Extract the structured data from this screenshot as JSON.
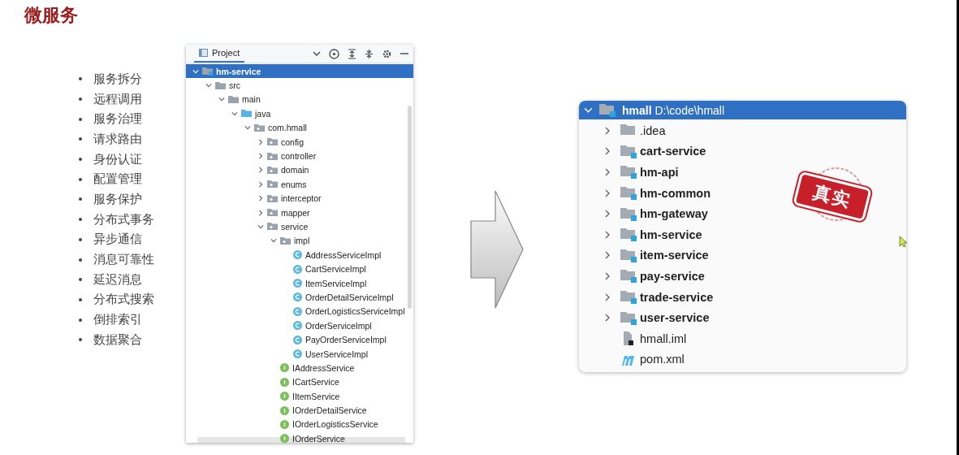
{
  "title": "微服务",
  "topics": [
    "服务拆分",
    "远程调用",
    "服务治理",
    "请求路由",
    "身份认证",
    "配置管理",
    "服务保护",
    "分布式事务",
    "异步通信",
    "消息可靠性",
    "延迟消息",
    "分布式搜索",
    "倒排索引",
    "数据聚合"
  ],
  "project_panel": {
    "tab": "Project",
    "tree": [
      {
        "label": "hm-service",
        "kind": "module",
        "expanded": true,
        "selected": true,
        "children": [
          {
            "label": "src",
            "kind": "folder",
            "expanded": true,
            "selected": false,
            "children": [
              {
                "label": "main",
                "kind": "folder",
                "expanded": true,
                "selected": false,
                "children": [
                  {
                    "label": "java",
                    "kind": "source",
                    "expanded": true,
                    "selected": false,
                    "children": [
                      {
                        "label": "com.hmall",
                        "kind": "package",
                        "expanded": true,
                        "selected": false,
                        "children": [
                          {
                            "label": "config",
                            "kind": "package",
                            "expanded": false,
                            "selected": false
                          },
                          {
                            "label": "controller",
                            "kind": "package",
                            "expanded": false,
                            "selected": false
                          },
                          {
                            "label": "domain",
                            "kind": "package",
                            "expanded": false,
                            "selected": false
                          },
                          {
                            "label": "enums",
                            "kind": "package",
                            "expanded": false,
                            "selected": false
                          },
                          {
                            "label": "interceptor",
                            "kind": "package",
                            "expanded": false,
                            "selected": false
                          },
                          {
                            "label": "mapper",
                            "kind": "package",
                            "expanded": false,
                            "selected": false
                          },
                          {
                            "label": "service",
                            "kind": "package",
                            "expanded": true,
                            "selected": false,
                            "children": [
                              {
                                "label": "impl",
                                "kind": "package",
                                "expanded": true,
                                "selected": false,
                                "children": [
                                  {
                                    "label": "AddressServiceImpl",
                                    "kind": "class",
                                    "selected": false
                                  },
                                  {
                                    "label": "CartServiceImpl",
                                    "kind": "class",
                                    "selected": false
                                  },
                                  {
                                    "label": "ItemServiceImpl",
                                    "kind": "class",
                                    "selected": false
                                  },
                                  {
                                    "label": "OrderDetailServiceImpl",
                                    "kind": "class",
                                    "selected": false
                                  },
                                  {
                                    "label": "OrderLogisticsServiceImpl",
                                    "kind": "class",
                                    "selected": false
                                  },
                                  {
                                    "label": "OrderServiceImpl",
                                    "kind": "class",
                                    "selected": false
                                  },
                                  {
                                    "label": "PayOrderServiceImpl",
                                    "kind": "class",
                                    "selected": false
                                  },
                                  {
                                    "label": "UserServiceImpl",
                                    "kind": "class",
                                    "selected": false
                                  }
                                ]
                              },
                              {
                                "label": "IAddressService",
                                "kind": "interface",
                                "selected": false
                              },
                              {
                                "label": "ICartService",
                                "kind": "interface",
                                "selected": false
                              },
                              {
                                "label": "IItemService",
                                "kind": "interface",
                                "selected": false
                              },
                              {
                                "label": "IOrderDetailService",
                                "kind": "interface",
                                "selected": false
                              },
                              {
                                "label": "IOrderLogisticsService",
                                "kind": "interface",
                                "selected": false
                              },
                              {
                                "label": "IOrderService",
                                "kind": "interface",
                                "selected": false
                              }
                            ]
                          }
                        ]
                      }
                    ]
                  }
                ]
              }
            ]
          }
        ]
      }
    ]
  },
  "hmall_panel": {
    "root": {
      "label": "hmall",
      "path": "D:\\code\\hmall",
      "expanded": true,
      "selected": true
    },
    "items": [
      {
        "label": ".idea",
        "kind": "folder",
        "expanded": false
      },
      {
        "label": "cart-service",
        "kind": "module",
        "expanded": false
      },
      {
        "label": "hm-api",
        "kind": "module",
        "expanded": false
      },
      {
        "label": "hm-common",
        "kind": "module",
        "expanded": false
      },
      {
        "label": "hm-gateway",
        "kind": "module",
        "expanded": false
      },
      {
        "label": "hm-service",
        "kind": "module",
        "expanded": false
      },
      {
        "label": "item-service",
        "kind": "module",
        "expanded": false
      },
      {
        "label": "pay-service",
        "kind": "module",
        "expanded": false
      },
      {
        "label": "trade-service",
        "kind": "module",
        "expanded": false
      },
      {
        "label": "user-service",
        "kind": "module",
        "expanded": false
      },
      {
        "label": "hmall.iml",
        "kind": "iml"
      },
      {
        "label": "pom.xml",
        "kind": "pom"
      }
    ],
    "stamp": "真实"
  }
}
